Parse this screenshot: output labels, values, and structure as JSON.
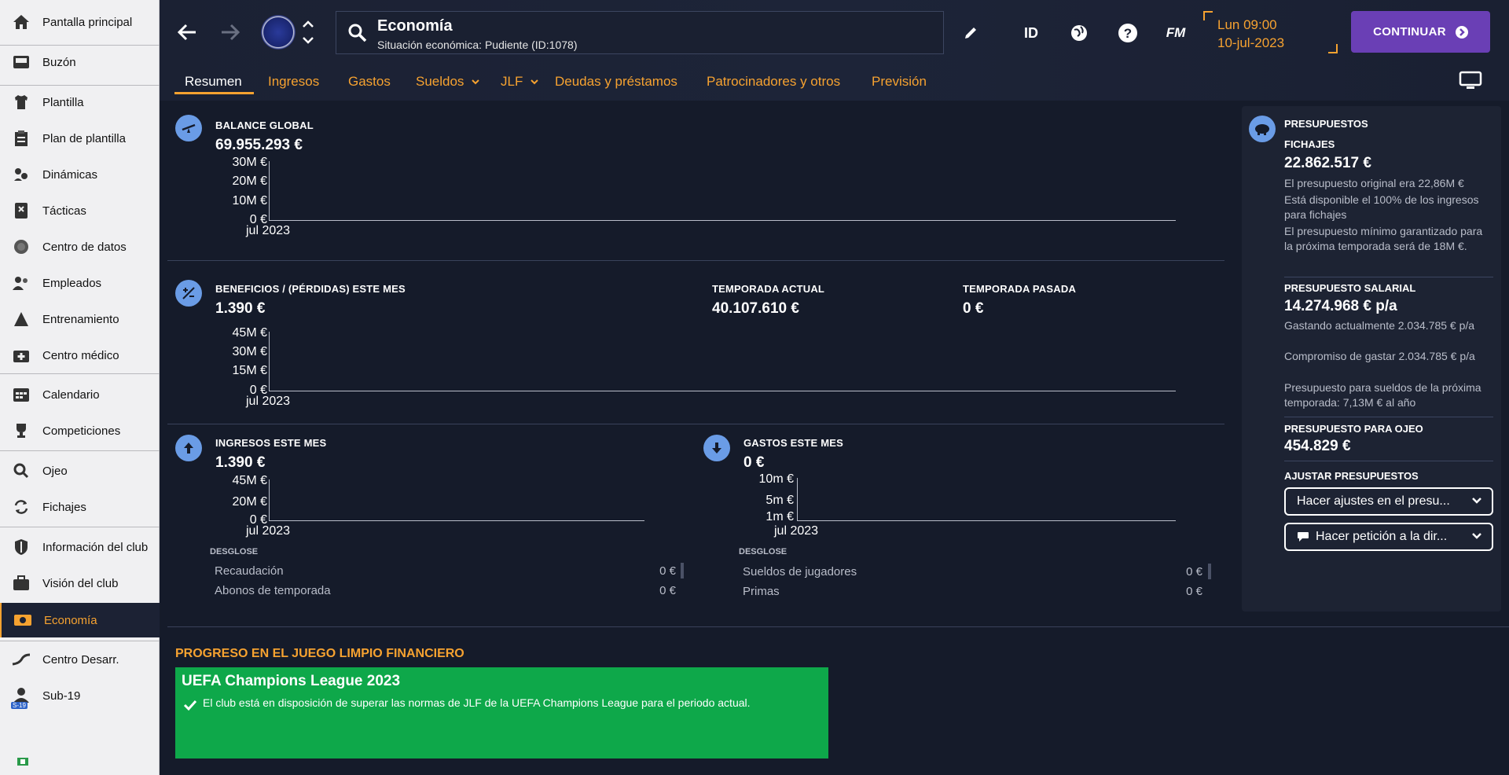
{
  "sidebar": {
    "items": [
      {
        "label": "Pantalla principal",
        "icon": "home-icon"
      },
      {
        "label": "Buzón",
        "icon": "inbox-icon"
      },
      {
        "label": "Plantilla",
        "icon": "shirt-icon"
      },
      {
        "label": "Plan de plantilla",
        "icon": "clipboard-icon"
      },
      {
        "label": "Dinámicas",
        "icon": "dynamics-icon"
      },
      {
        "label": "Tácticas",
        "icon": "tactics-icon"
      },
      {
        "label": "Centro de datos",
        "icon": "data-icon"
      },
      {
        "label": "Empleados",
        "icon": "staff-icon"
      },
      {
        "label": "Entrenamiento",
        "icon": "training-icon"
      },
      {
        "label": "Centro médico",
        "icon": "medical-icon"
      },
      {
        "label": "Calendario",
        "icon": "calendar-icon"
      },
      {
        "label": "Competiciones",
        "icon": "trophy-icon"
      },
      {
        "label": "Ojeo",
        "icon": "scouting-icon"
      },
      {
        "label": "Fichajes",
        "icon": "transfers-icon"
      },
      {
        "label": "Información del club",
        "icon": "shield-icon"
      },
      {
        "label": "Visión del club",
        "icon": "briefcase-icon"
      },
      {
        "label": "Economía",
        "icon": "money-icon"
      },
      {
        "label": "Centro Desarr.",
        "icon": "development-icon"
      },
      {
        "label": "Sub-19",
        "icon": "u19-icon",
        "badge": "S-19"
      }
    ]
  },
  "header": {
    "title": "Economía",
    "subtitle": "Situación económica: Pudiente (ID:1078)",
    "id_label": "ID",
    "fm_label": "FM",
    "day_time": "Lun 09:00",
    "date": "10-jul-2023",
    "continue_label": "CONTINUAR"
  },
  "tabs": [
    {
      "label": "Resumen",
      "active": true
    },
    {
      "label": "Ingresos"
    },
    {
      "label": "Gastos"
    },
    {
      "label": "Sueldos",
      "dropdown": true
    },
    {
      "label": "JLF",
      "dropdown": true
    },
    {
      "label": "Deudas y préstamos"
    },
    {
      "label": "Patrocinadores y otros"
    },
    {
      "label": "Previsión"
    }
  ],
  "balance": {
    "label": "BALANCE GLOBAL",
    "value": "69.955.293 €",
    "ticks": [
      "30M €",
      "20M €",
      "10M €",
      "0 €"
    ],
    "xlabel": "jul 2023"
  },
  "profit": {
    "label": "BENEFICIOS / (PÉRDIDAS) ESTE MES",
    "value": "1.390 €",
    "current_label": "TEMPORADA ACTUAL",
    "current_value": "40.107.610 €",
    "last_label": "TEMPORADA PASADA",
    "last_value": "0 €",
    "ticks": [
      "45M €",
      "30M €",
      "15M €",
      "0 €"
    ],
    "xlabel": "jul 2023"
  },
  "income": {
    "label": "INGRESOS ESTE MES",
    "value": "1.390 €",
    "ticks": [
      "45M €",
      "20M €",
      "0 €"
    ],
    "xlabel": "jul 2023",
    "breakdown_label": "DESGLOSE",
    "rows": [
      {
        "name": "Recaudación",
        "value": "0 €"
      },
      {
        "name": "Abonos de temporada",
        "value": "0 €"
      }
    ]
  },
  "expenses": {
    "label": "GASTOS ESTE MES",
    "value": "0 €",
    "ticks": [
      "10m €",
      "5m €",
      "1m €"
    ],
    "xlabel": "jul 2023",
    "breakdown_label": "DESGLOSE",
    "rows": [
      {
        "name": "Sueldos de jugadores",
        "value": "0 €"
      },
      {
        "name": "Primas",
        "value": "0 €"
      }
    ]
  },
  "budgets": {
    "title": "PRESUPUESTOS",
    "transfer_label": "FICHAJES",
    "transfer_value": "22.862.517 €",
    "transfer_notes": [
      "El presupuesto original era 22,86M €",
      "Está disponible el 100% de los ingresos para fichajes",
      "El presupuesto mínimo garantizado para la próxima temporada será de 18M €."
    ],
    "wage_label": "PRESUPUESTO SALARIAL",
    "wage_value": "14.274.968 € p/a",
    "wage_notes": [
      "Gastando actualmente 2.034.785 € p/a",
      "Compromiso de gastar 2.034.785 € p/a",
      "Presupuesto para sueldos de la próxima temporada: 7,13M € al año"
    ],
    "scouting_label": "PRESUPUESTO PARA OJEO",
    "scouting_value": "454.829 €",
    "adjust_label": "AJUSTAR PRESUPUESTOS",
    "adjust_button": "Hacer ajustes en el presu...",
    "request_button": "Hacer petición a la dir..."
  },
  "ffp": {
    "title": "PROGRESO EN EL JUEGO LIMPIO FINANCIERO",
    "competition": "UEFA Champions League 2023",
    "message": "El club está en disposición de superar las normas de JLF de la UEFA Champions League para el periodo actual."
  },
  "colors": {
    "accent": "#f6a230",
    "continue": "#6a3fb5",
    "ffp_green": "#0ea84a",
    "icon_blue": "#6a9ce6"
  }
}
